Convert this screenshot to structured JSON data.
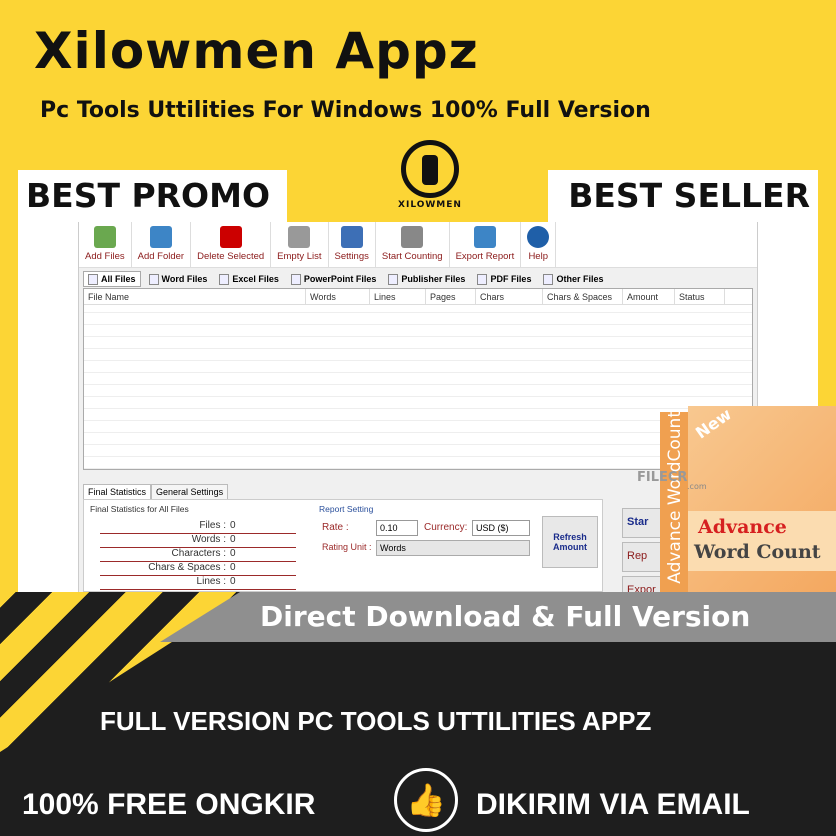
{
  "promo": {
    "title": "Xilowmen Appz",
    "subtitle": "Pc Tools Uttilities For Windows 100% Full Version",
    "logo_text": "XILOWMEN",
    "badge_left": "BEST PROMO",
    "badge_right": "BEST SELLER",
    "banner": "Direct Download & Full Version",
    "line1": "FULL VERSION  PC TOOLS UTTILITIES  APPZ",
    "line2_left": "100% FREE ONGKIR",
    "line2_right": "DIKIRIM VIA EMAIL",
    "accent": "#fcd535",
    "dark": "#1e1e1e"
  },
  "toolbar": [
    {
      "label": "Add Files",
      "icon": "add-file-icon",
      "color": "#6aa84f"
    },
    {
      "label": "Add Folder",
      "icon": "folder-icon",
      "color": "#3d85c6"
    },
    {
      "label": "Delete Selected",
      "icon": "delete-icon",
      "color": "#cc0000"
    },
    {
      "label": "Empty List",
      "icon": "trash-icon",
      "color": "#999999"
    },
    {
      "label": "Settings",
      "icon": "tools-icon",
      "color": "#3d6fb6"
    },
    {
      "label": "Start Counting",
      "icon": "gear-icon",
      "color": "#888888"
    },
    {
      "label": "Export Report",
      "icon": "export-icon",
      "color": "#3d85c6"
    },
    {
      "label": "Help",
      "icon": "help-icon",
      "color": "#1f5fa8"
    }
  ],
  "tabs": [
    {
      "label": "All Files",
      "active": true
    },
    {
      "label": "Word Files"
    },
    {
      "label": "Excel Files"
    },
    {
      "label": "PowerPoint Files"
    },
    {
      "label": "Publisher Files"
    },
    {
      "label": "PDF Files"
    },
    {
      "label": "Other Files"
    }
  ],
  "columns": [
    "File Name",
    "Words",
    "Lines",
    "Pages",
    "Chars",
    "Chars & Spaces",
    "Amount",
    "Status"
  ],
  "bottom_tabs": [
    "Final Statistics",
    "General Settings"
  ],
  "stats": {
    "title": "Final Statistics for All Files",
    "rows": [
      {
        "label": "Files :",
        "value": "0"
      },
      {
        "label": "Words :",
        "value": "0"
      },
      {
        "label": "Characters :",
        "value": "0"
      },
      {
        "label": "Chars & Spaces :",
        "value": "0"
      },
      {
        "label": "Lines :",
        "value": "0"
      }
    ]
  },
  "report": {
    "title": "Report Setting",
    "rate_label": "Rate :",
    "rate_value": "0.10",
    "currency_label": "Currency:",
    "currency_value": "USD ($)",
    "unit_label": "Rating Unit :",
    "unit_value": "Words",
    "refresh": "Refresh Amount"
  },
  "side_buttons": [
    "Star",
    "Rep",
    "Expor"
  ],
  "product": {
    "new": "New",
    "spine": "Advance WordCount",
    "name1": "Advance",
    "name2": "Word Count"
  },
  "watermark": {
    "filecr": "FILECR",
    "filecr_sub": ".com"
  }
}
